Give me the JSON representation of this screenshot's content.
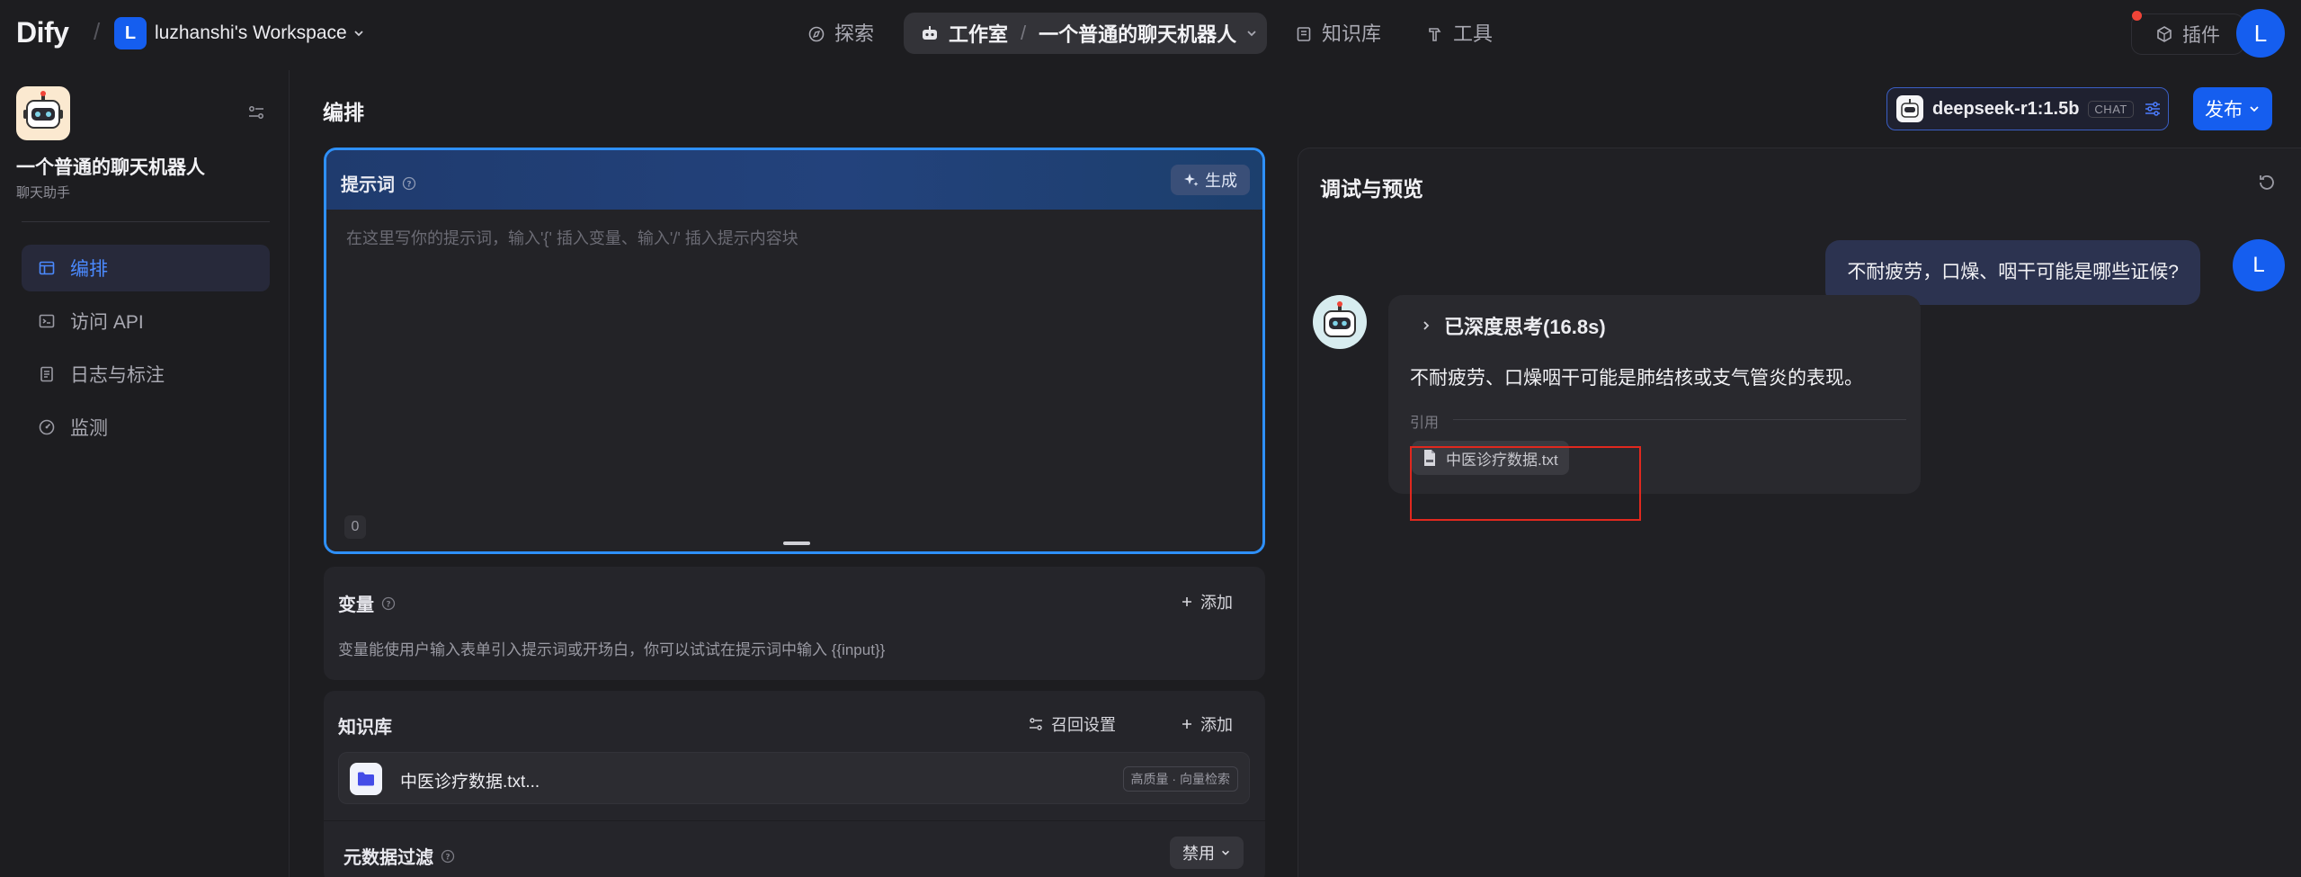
{
  "header": {
    "logo": "Dify",
    "workspace_initial": "L",
    "workspace_name": "luzhanshi's Workspace",
    "nav": {
      "explore": "探索",
      "studio": "工作室",
      "current_app": "一个普通的聊天机器人",
      "knowledge": "知识库",
      "tools": "工具"
    },
    "plugins": "插件",
    "user_initial": "L"
  },
  "sidebar": {
    "app_name": "一个普通的聊天机器人",
    "app_type": "聊天助手",
    "items": [
      {
        "label": "编排",
        "icon": "layout-icon",
        "active": true
      },
      {
        "label": "访问 API",
        "icon": "terminal-icon",
        "active": false
      },
      {
        "label": "日志与标注",
        "icon": "file-list-icon",
        "active": false
      },
      {
        "label": "监测",
        "icon": "dashboard-icon",
        "active": false
      }
    ]
  },
  "main": {
    "title": "编排",
    "model": {
      "name": "deepseek-r1:1.5b",
      "mode": "CHAT"
    },
    "publish": "发布",
    "prompt": {
      "label": "提示词",
      "generate": "生成",
      "placeholder": "在这里写你的提示词，输入'{' 插入变量、输入'/' 插入提示内容块",
      "count": "0"
    },
    "variables": {
      "title": "变量",
      "add": "添加",
      "desc": "变量能使用户输入表单引入提示词或开场白，你可以试试在提示词中输入 {{input}}"
    },
    "knowledge": {
      "title": "知识库",
      "retrieval": "召回设置",
      "add": "添加",
      "item_name": "中医诊疗数据.txt...",
      "item_badge": "高质量 · 向量检索"
    },
    "metadata": {
      "title": "元数据过滤",
      "value": "禁用"
    }
  },
  "debug": {
    "title": "调试与预览",
    "user_message": "不耐疲劳，口燥、咽干可能是哪些证候?",
    "user_initial": "L",
    "thinking": "已深度思考(16.8s)",
    "answer": "不耐疲劳、口燥咽干可能是肺结核或支气管炎的表现。",
    "citation_label": "引用",
    "citation_file": "中医诊疗数据.txt"
  },
  "colors": {
    "accent": "#155eef",
    "prompt_border": "#2e90fa",
    "highlight": "#e0281e"
  }
}
